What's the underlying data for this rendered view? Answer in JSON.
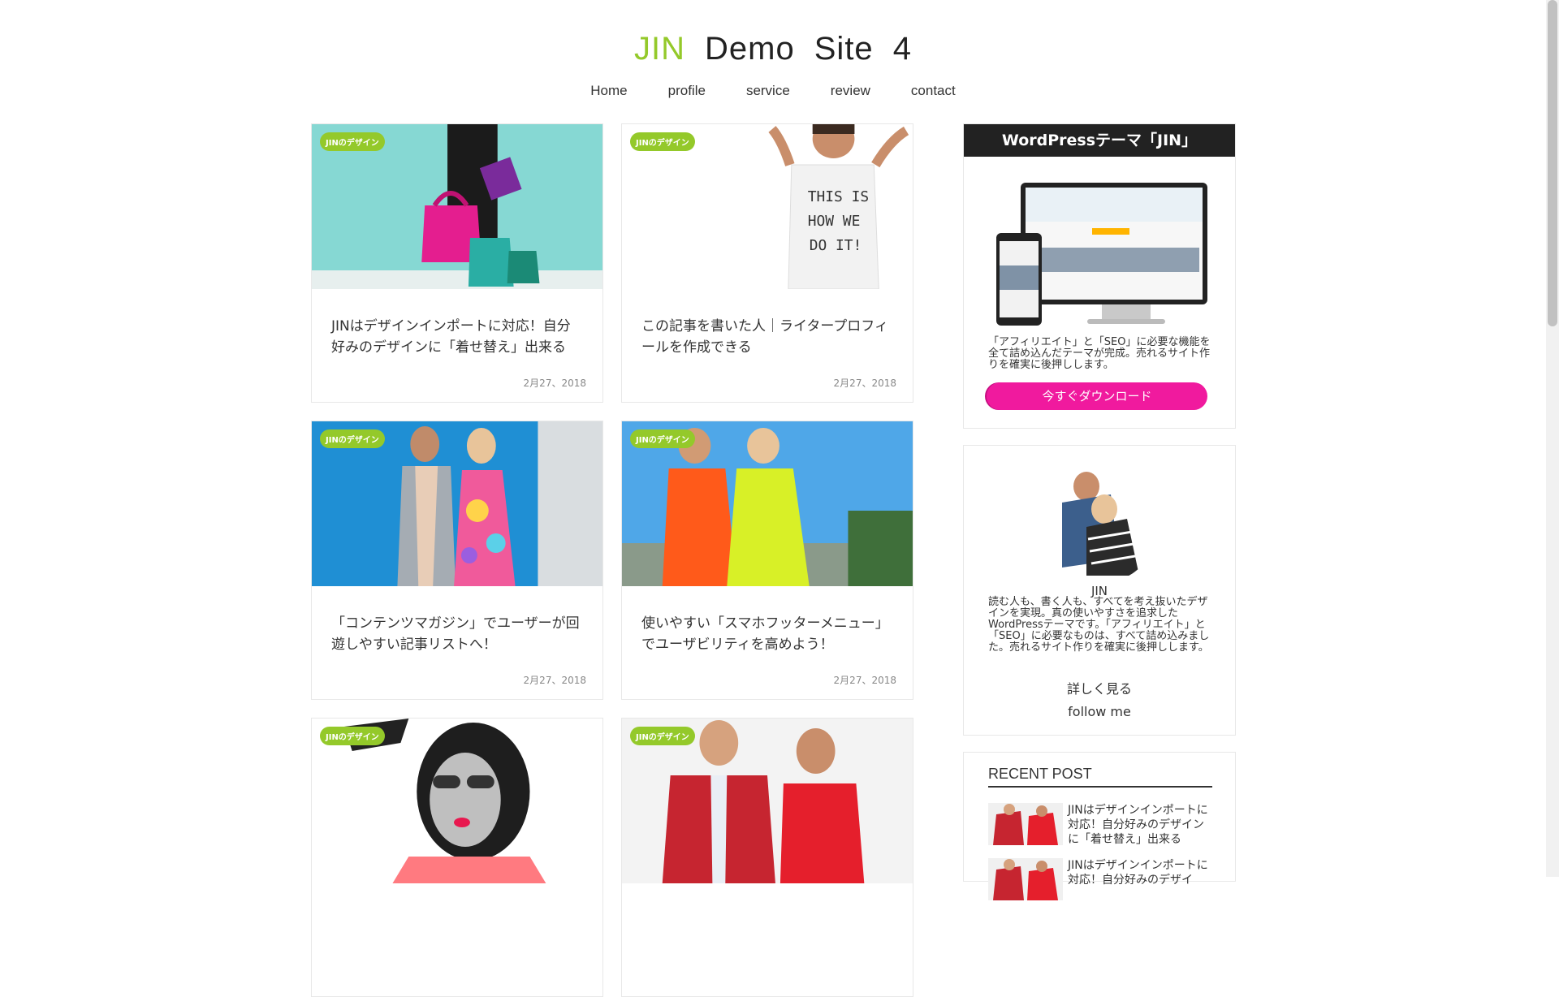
{
  "site": {
    "title_parts": [
      "JIN",
      "Demo",
      "Site",
      "4"
    ],
    "accent_color": "#94c92a"
  },
  "nav": {
    "items": [
      "Home",
      "profile",
      "service",
      "review",
      "contact"
    ]
  },
  "posts": [
    {
      "category": "JINのデザイン",
      "title": "JINはデザインインポートに対応！自分好みのデザインに「着せ替え」出来る",
      "date": "2月27、2018"
    },
    {
      "category": "JINのデザイン",
      "title": "この記事を書いた人｜ライタープロフィールを作成できる",
      "date": "2月27、2018"
    },
    {
      "category": "JINのデザイン",
      "title": "「コンテンツマガジン」でユーザーが回遊しやすい記事リストへ！",
      "date": "2月27、2018"
    },
    {
      "category": "JINのデザイン",
      "title": "使いやすい「スマホフッターメニュー」でユーザビリティを高めよう！",
      "date": "2月27、2018"
    },
    {
      "category": "JINのデザイン",
      "title": "",
      "date": ""
    },
    {
      "category": "JINのデザイン",
      "title": "",
      "date": ""
    }
  ],
  "theme_widget": {
    "title": "WordPressテーマ「JIN」",
    "description": "「アフィリエイト」と「SEO」に必要な機能を全て詰め込んだテーマが完成。売れるサイト作りを確実に後押しします。",
    "button_label": "今すぐダウンロード",
    "button_color": "#f01a9e"
  },
  "profile_widget": {
    "name": "JIN",
    "bio": "読む人も、書く人も、すべてを考え抜いたデザインを実現。真の使いやすさを追求したWordPressテーマです。「アフィリエイト」と「SEO」に必要なものは、すべて詰め込みました。売れるサイト作りを確実に後押しします。",
    "more_label": "詳しく見る",
    "follow_label": "follow me"
  },
  "recent_widget": {
    "title": "RECENT POST",
    "items": [
      "JINはデザインインポートに対応！自分好みのデザインに「着せ替え」出来る",
      "JINはデザインインポートに対応！自分好みのデザイ"
    ]
  }
}
